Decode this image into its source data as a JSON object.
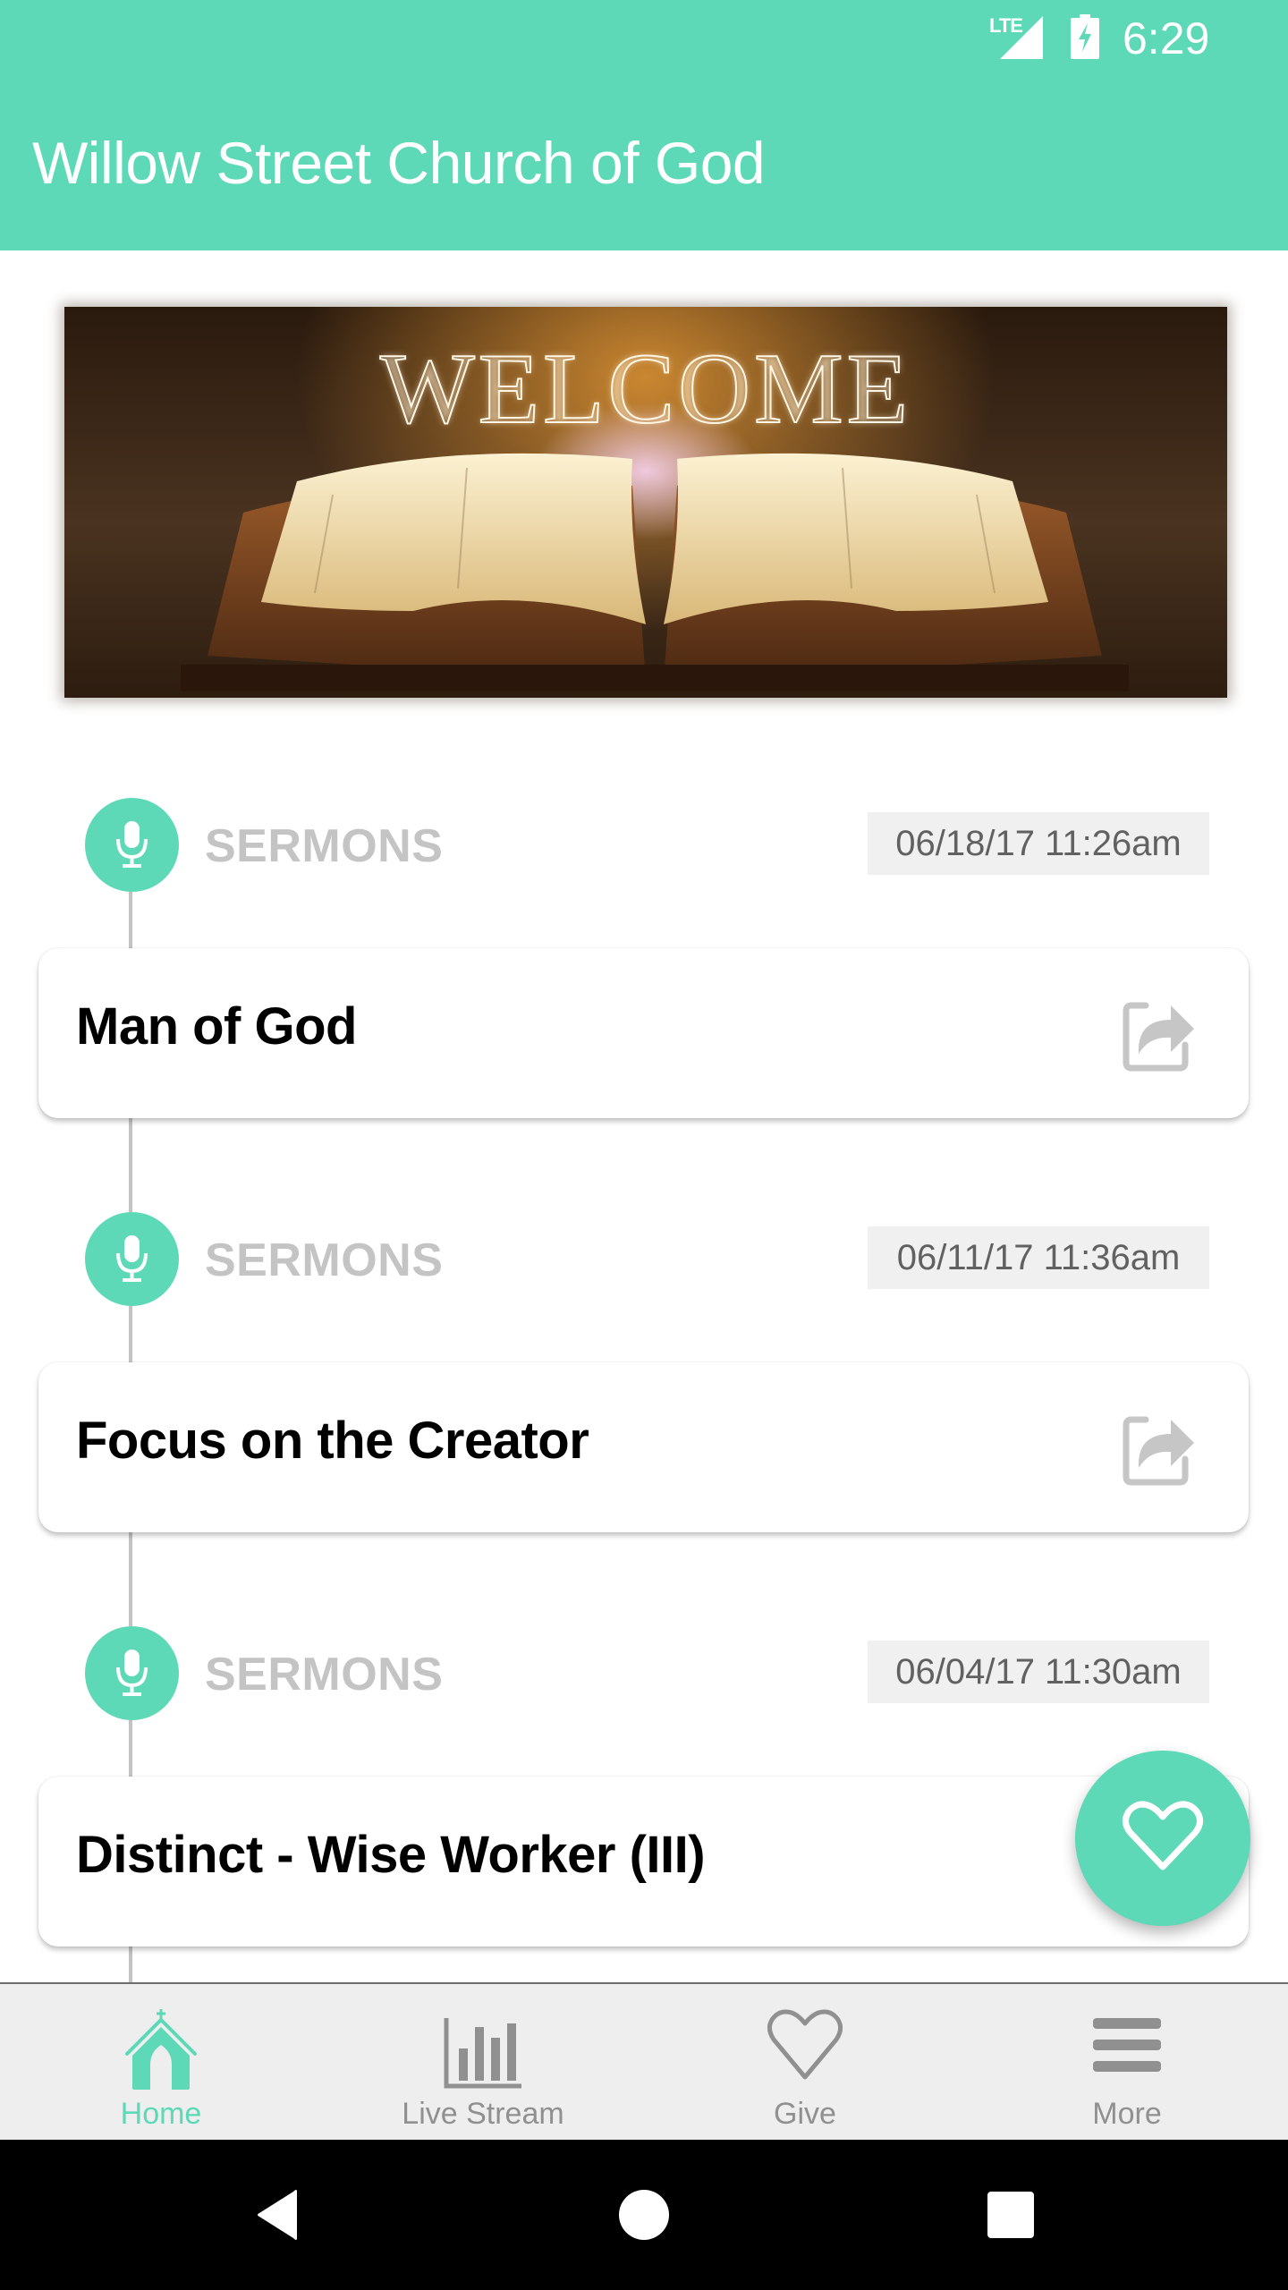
{
  "status_bar": {
    "network": "LTE",
    "time": "6:29",
    "icons": [
      "lte-signal-icon",
      "battery-charging-icon"
    ]
  },
  "app_bar": {
    "title": "Willow Street Church of God"
  },
  "banner": {
    "text": "WELCOME",
    "image": "open-bible-image"
  },
  "feed": {
    "entries": [
      {
        "category": "SERMONS",
        "category_icon": "microphone-icon",
        "date": "06/18/17 11:26am",
        "title": "Man of God",
        "action_icon": "share-icon"
      },
      {
        "category": "SERMONS",
        "category_icon": "microphone-icon",
        "date": "06/11/17 11:36am",
        "title": "Focus on the Creator",
        "action_icon": "share-icon"
      },
      {
        "category": "SERMONS",
        "category_icon": "microphone-icon",
        "date": "06/04/17 11:30am",
        "title": "Distinct - Wise Worker (III)",
        "action_icon": "share-icon"
      }
    ]
  },
  "fab": {
    "icon": "heart-icon"
  },
  "bottom_nav": {
    "items": [
      {
        "label": "Home",
        "icon": "church-icon",
        "active": true
      },
      {
        "label": "Live Stream",
        "icon": "bar-chart-icon",
        "active": false
      },
      {
        "label": "Give",
        "icon": "heart-icon",
        "active": false
      },
      {
        "label": "More",
        "icon": "menu-icon",
        "active": false
      }
    ]
  },
  "system_nav": {
    "buttons": [
      "back",
      "home",
      "recents"
    ]
  },
  "colors": {
    "accent": "#5dd9b7",
    "category_label": "#c4c4c4",
    "date_chip_bg": "#f0f0f0",
    "date_text": "#616161",
    "nav_inactive": "#909090",
    "nav_bg": "#eeeeee"
  }
}
